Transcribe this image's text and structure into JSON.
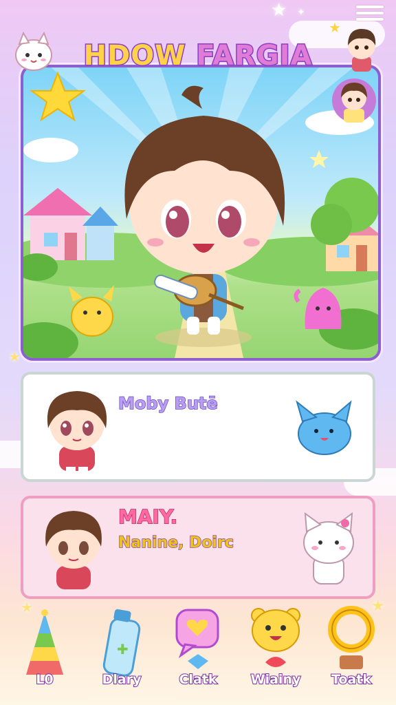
{
  "header": {
    "title_part1": "HDOW",
    "title_part2": "FARGIA"
  },
  "cards": [
    {
      "name": "Moby Butē",
      "subtitle": ""
    },
    {
      "name": "MAIY.",
      "subtitle": "Nanine, Doirc"
    }
  ],
  "dock": [
    {
      "label": "L0",
      "icon": "rainbow-tree-icon"
    },
    {
      "label": "Dlary",
      "icon": "bottle-icon"
    },
    {
      "label": "Clatk",
      "icon": "heart-bubble-icon"
    },
    {
      "label": "Wiainy",
      "icon": "bear-face-icon"
    },
    {
      "label": "Toatk",
      "icon": "ring-icon"
    }
  ],
  "colors": {
    "title_fill": "#ffd24a",
    "title_accent": "#e07bd6",
    "title_stroke": "#8a3fc4",
    "card1_border": "#c9d6d2",
    "card2_border": "#ee9fc1",
    "card2_bg": "#fbe1ec"
  }
}
